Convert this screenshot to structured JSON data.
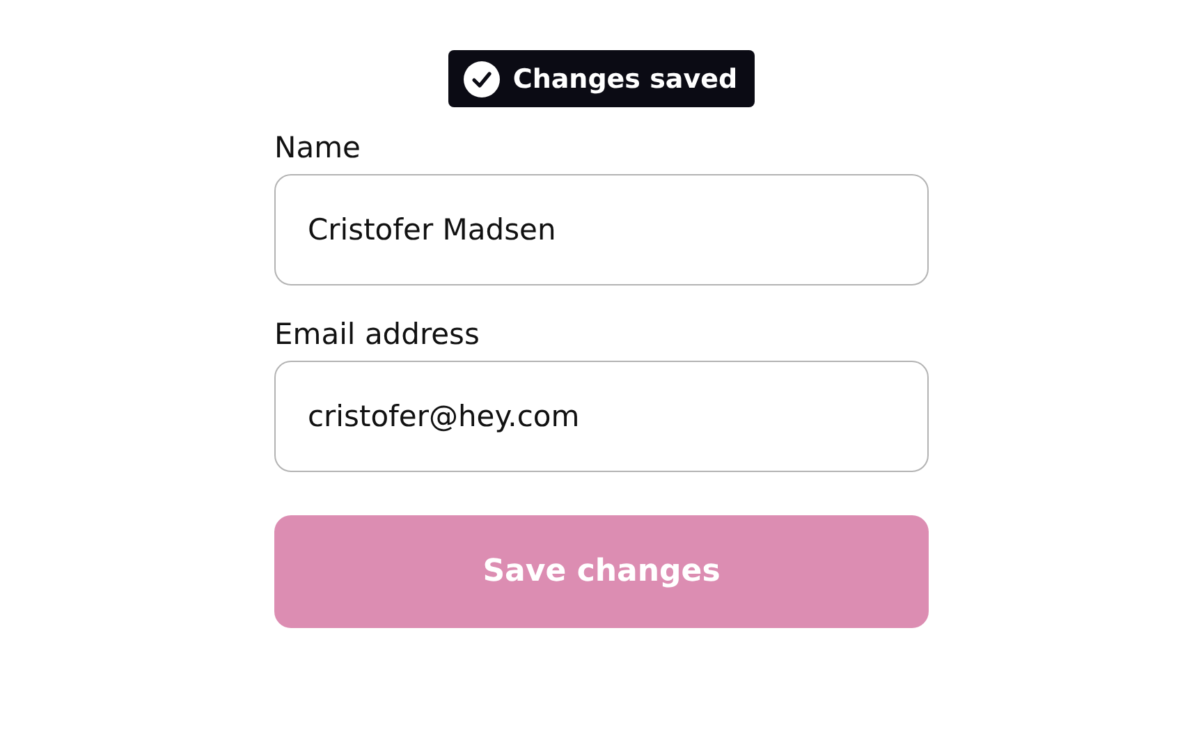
{
  "toast": {
    "text": "Changes saved"
  },
  "fields": [
    {
      "label": "Name",
      "value": "Cristofer Madsen"
    },
    {
      "label": "Email address",
      "value": "cristofer@hey.com"
    }
  ],
  "save_button": {
    "label": "Save changes",
    "disabled": true
  }
}
